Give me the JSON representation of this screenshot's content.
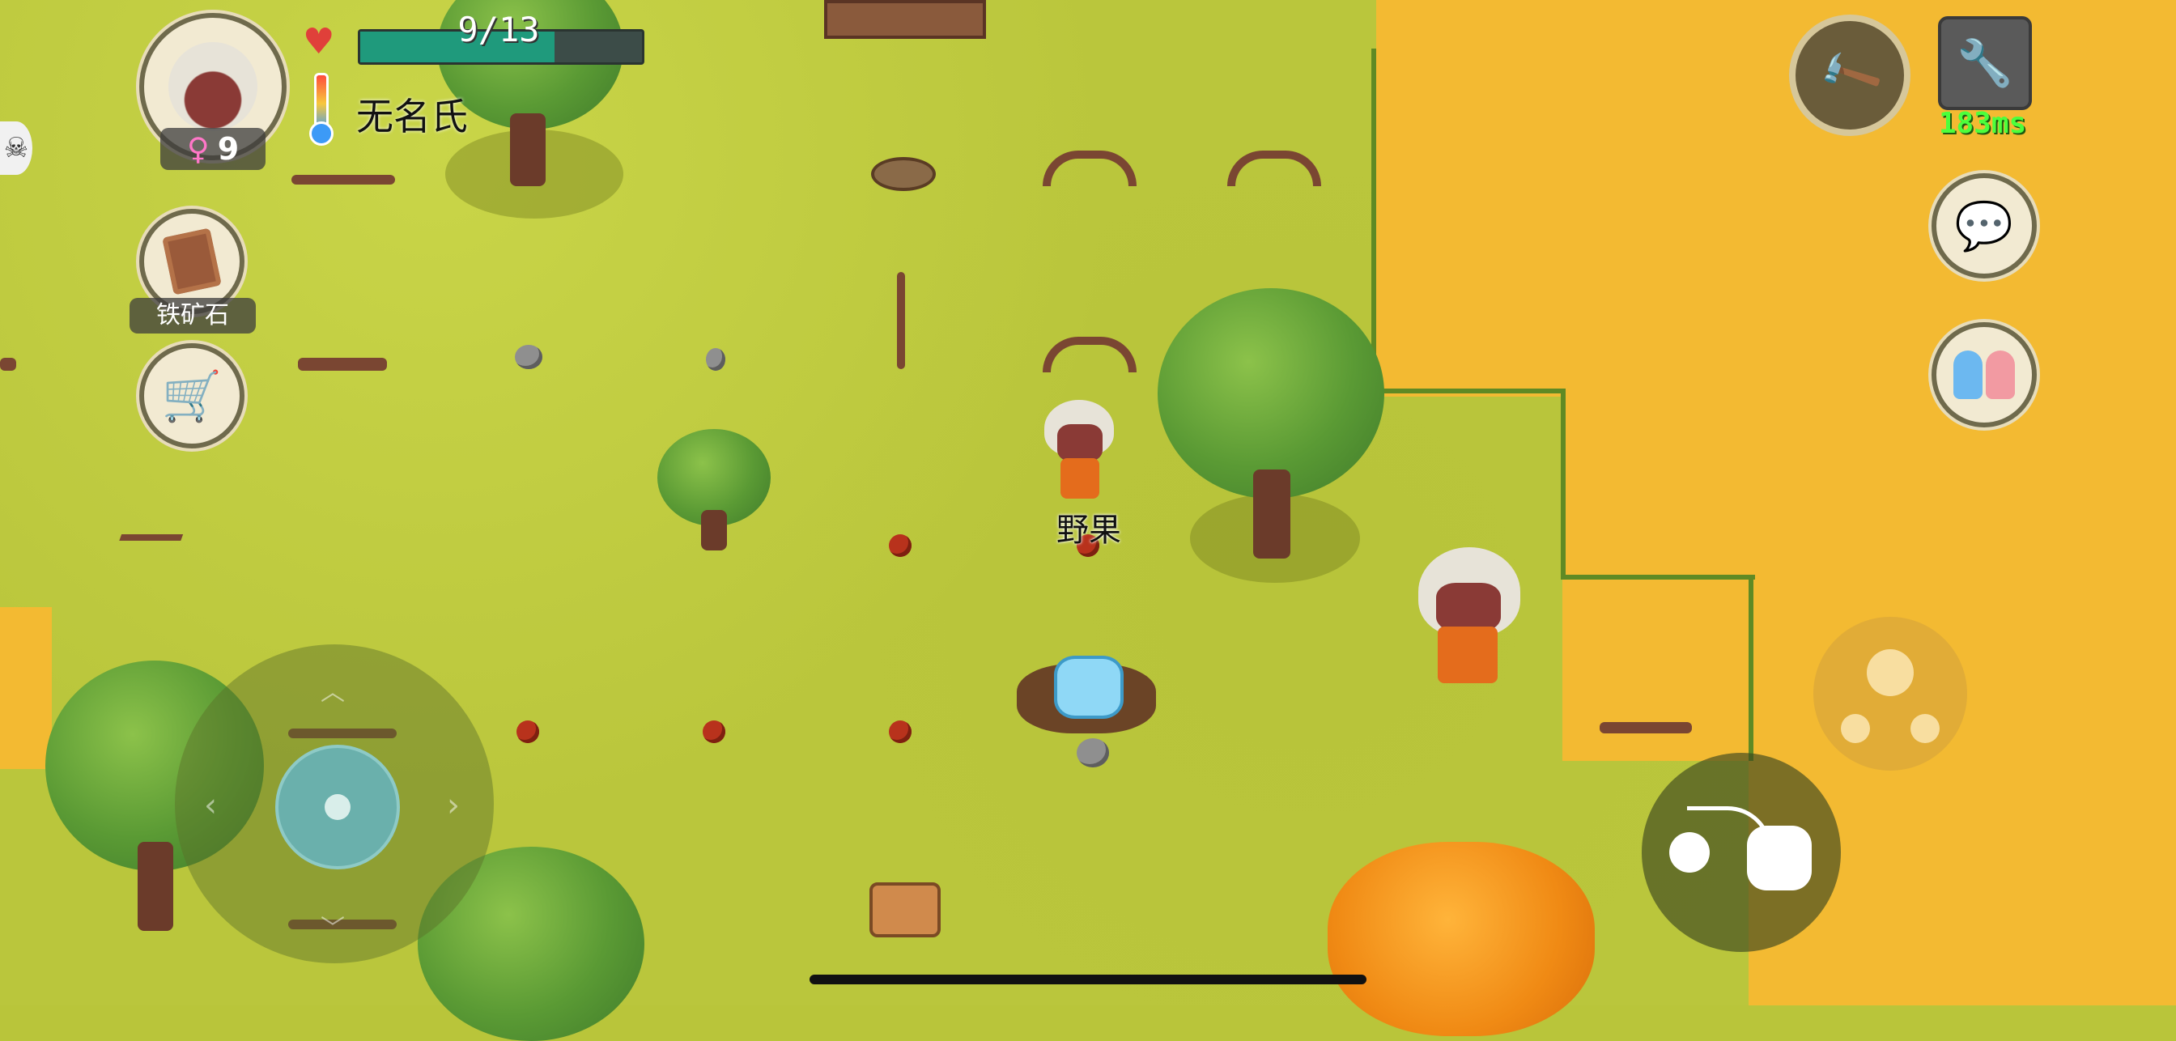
{
  "player": {
    "health_text": "9/13",
    "health_fraction": 0.69,
    "name": "无名氏",
    "age": "9",
    "gender_icon": "female-icon"
  },
  "held_item": {
    "label": "铁矿石"
  },
  "world": {
    "item_label_near_player": "野果"
  },
  "network": {
    "ping": "183ms"
  },
  "colors": {
    "health_bar": "#1f9a7c",
    "sand": "#f3ba32",
    "grass": "#bac63c",
    "ping_text": "#4cff3c"
  },
  "icons": {
    "top_right_action": "hammer-icon",
    "settings": "wrench-icon",
    "chat": "chat-bubble-icon",
    "social": "two-people-icon",
    "shop": "shopping-cart-icon",
    "throw": "throw-hand-icon",
    "emote": "emote-icon"
  }
}
